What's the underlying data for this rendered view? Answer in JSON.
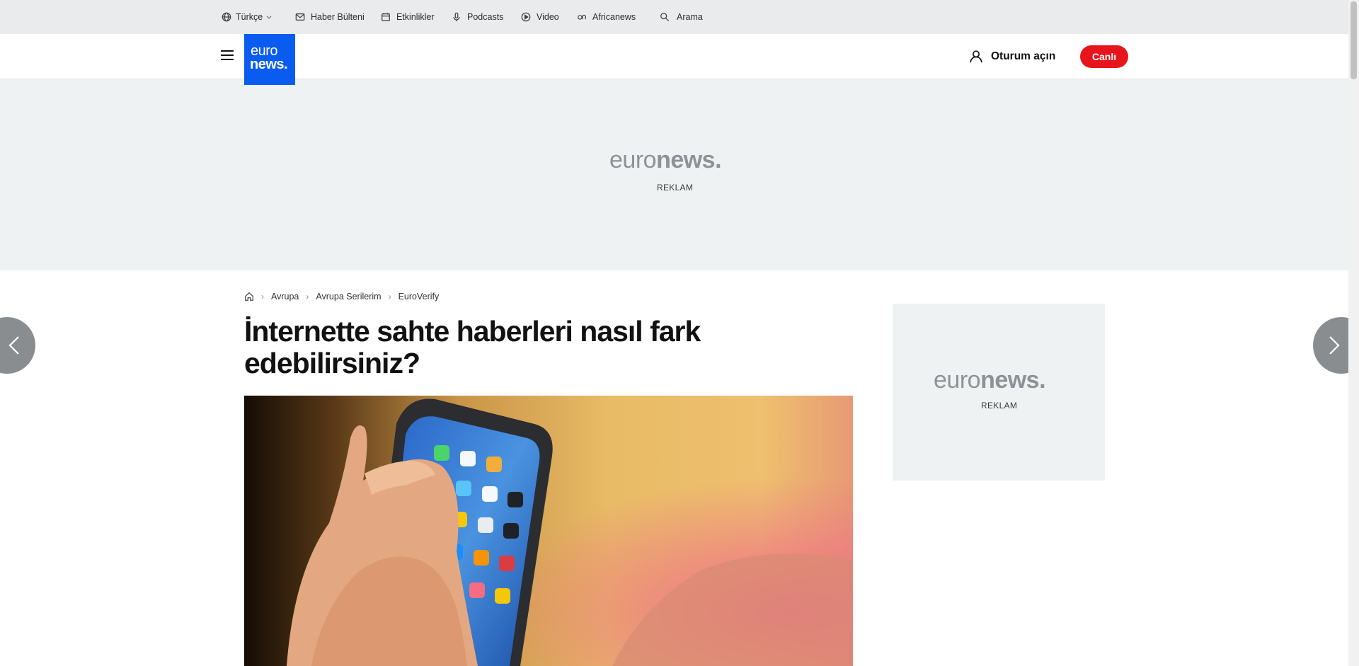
{
  "topbar": {
    "language": "Türkçe",
    "items": [
      {
        "label": "Haber Bülteni",
        "icon": "mail-icon"
      },
      {
        "label": "Etkinlikler",
        "icon": "calendar-icon"
      },
      {
        "label": "Podcasts",
        "icon": "microphone-icon"
      },
      {
        "label": "Video",
        "icon": "play-icon"
      },
      {
        "label": "Africanews",
        "icon": "africanews-icon"
      }
    ],
    "search_label": "Arama"
  },
  "header": {
    "logo_line1": "euro",
    "logo_line2": "news.",
    "signin_label": "Oturum açın",
    "live_label": "Canlı",
    "brand_color": "#0a5cf0",
    "live_color": "#e8141c"
  },
  "ads": {
    "banner_logo_light": "euro",
    "banner_logo_bold": "news.",
    "banner_label": "REKLAM",
    "side_logo_light": "euro",
    "side_logo_bold": "news.",
    "side_label": "REKLAM"
  },
  "breadcrumb": {
    "items": [
      "Avrupa",
      "Avrupa Serilerim",
      "EuroVerify"
    ]
  },
  "article": {
    "headline": "İnternette sahte haberleri nasıl fark edebilirsiniz?"
  }
}
